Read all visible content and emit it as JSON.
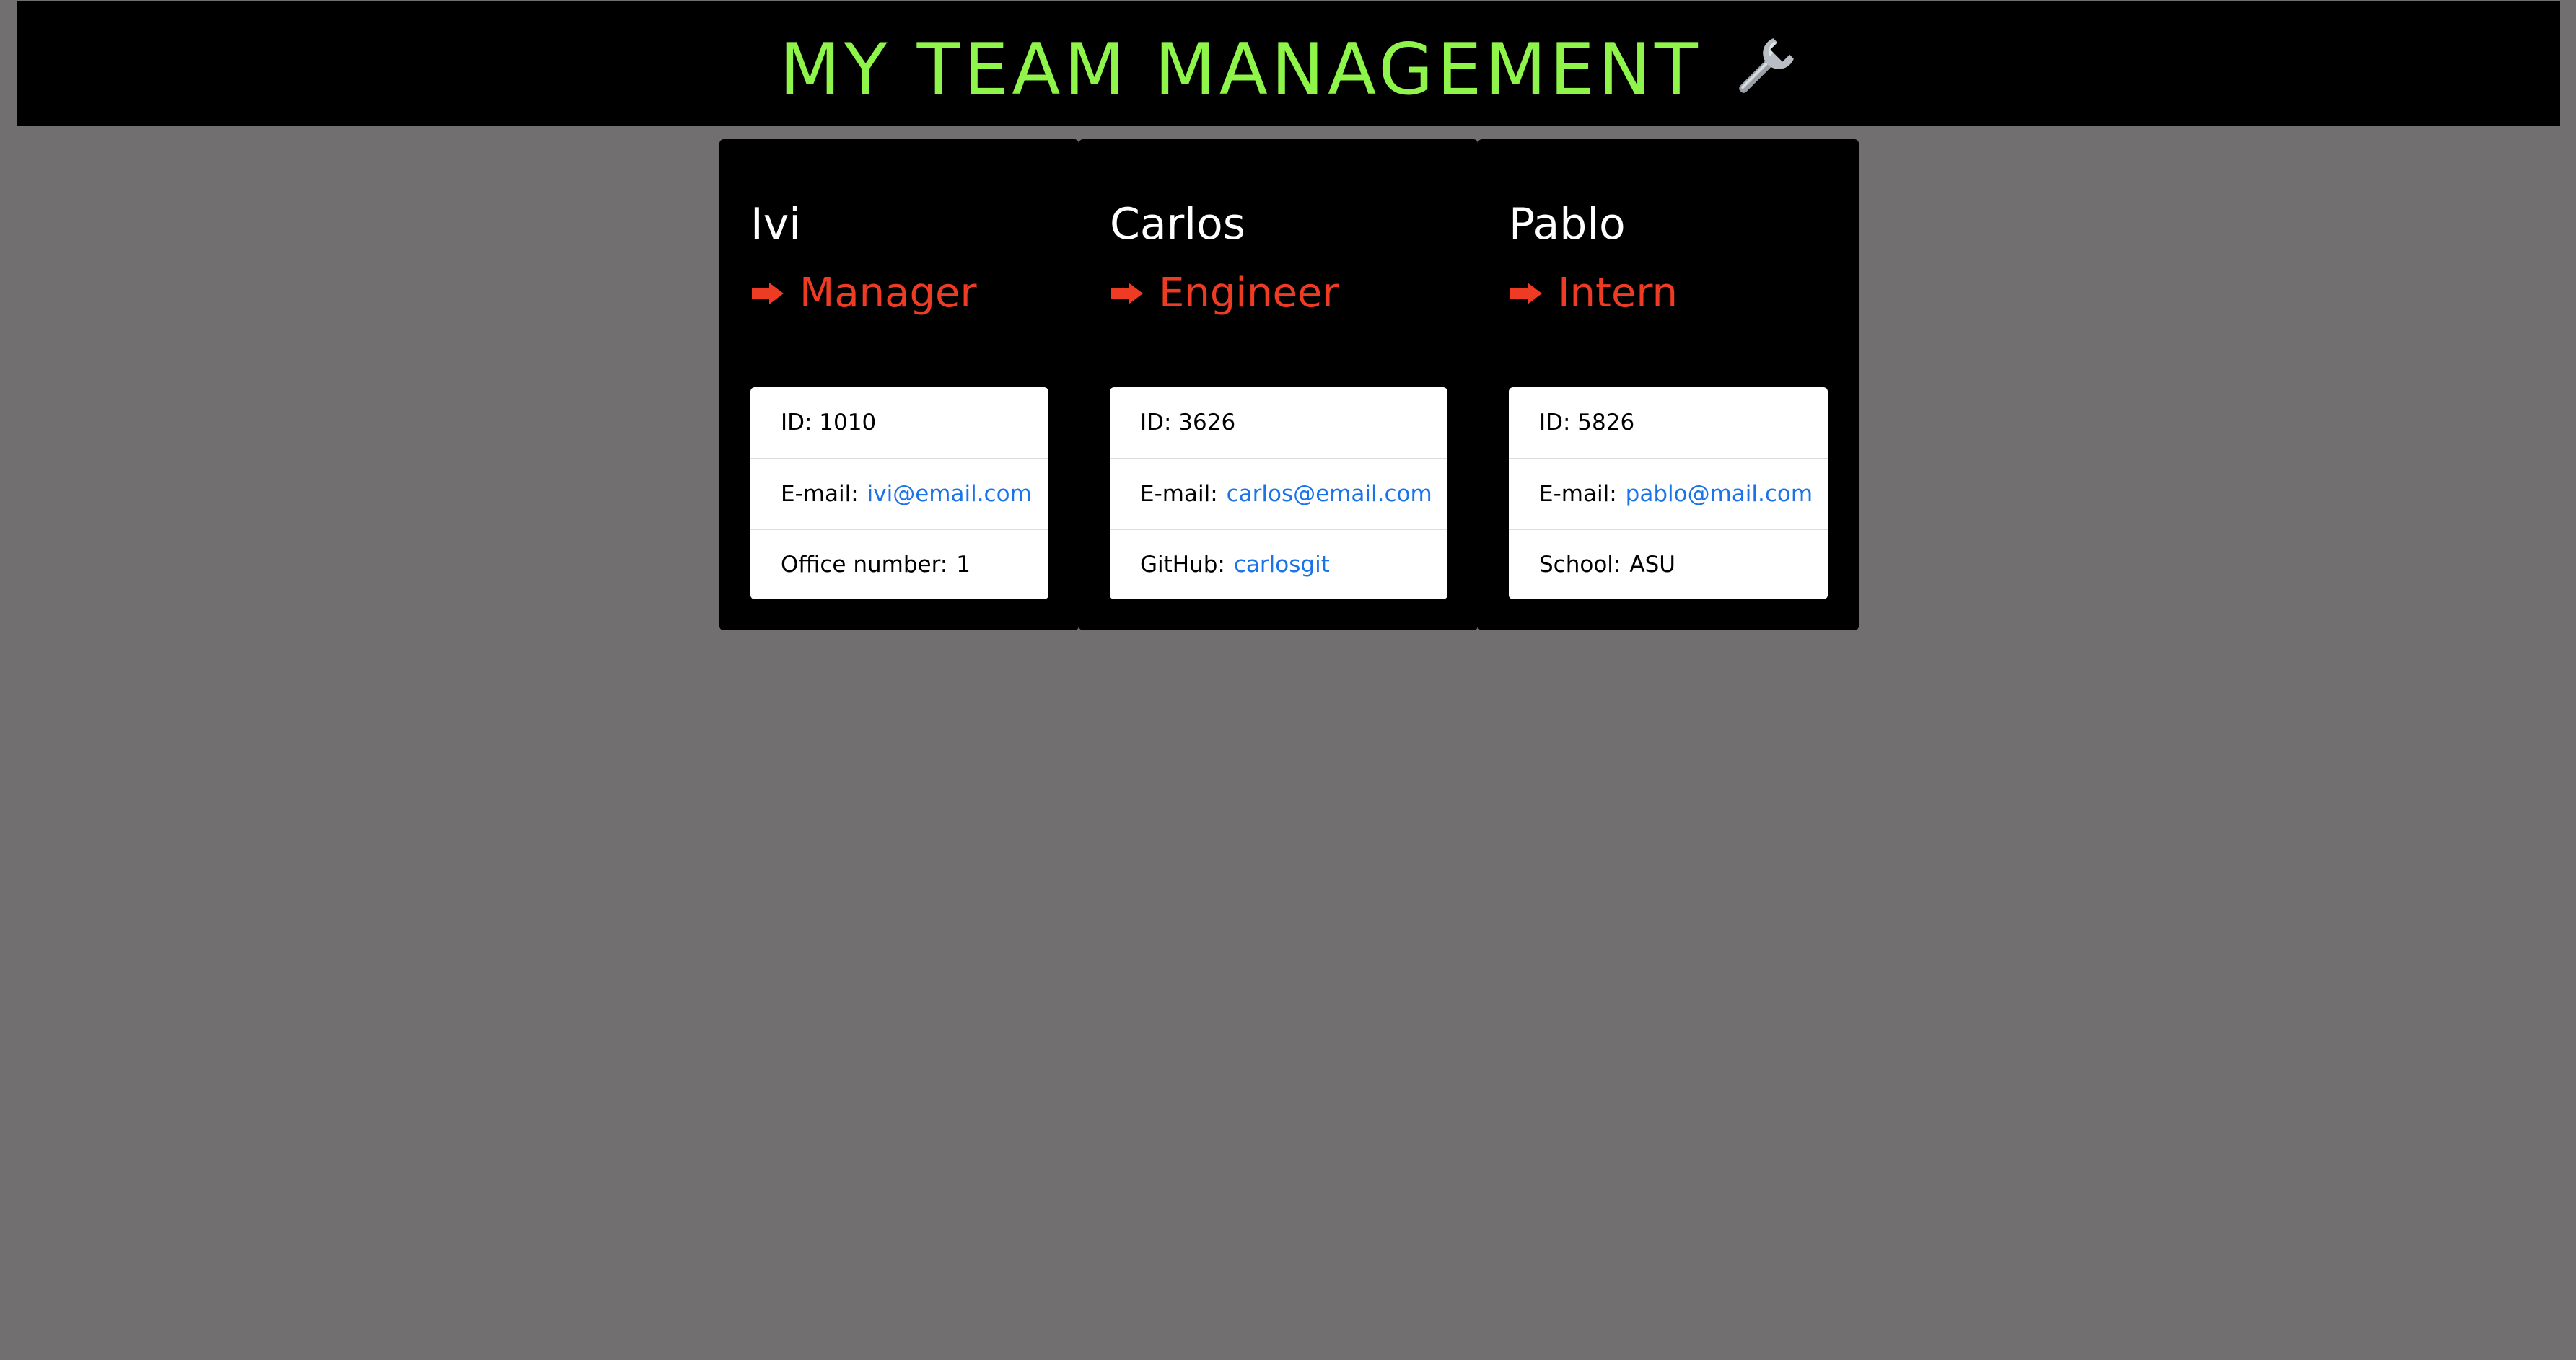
{
  "header": {
    "title": "MY TEAM MANAGEMENT",
    "icon": "wrench-icon"
  },
  "colors": {
    "background": "#716f70",
    "header_bg": "#000000",
    "title": "#8ff54a",
    "role": "#ee3b24",
    "link": "#1a73e8"
  },
  "team": [
    {
      "name": "Ivi",
      "role": "Manager",
      "id": "ID: 1010",
      "email_label": "E-mail:",
      "email": "ivi@email.com",
      "extra_label": "Office number:",
      "extra_value": "1"
    },
    {
      "name": "Carlos",
      "role": "Engineer",
      "id": "ID: 3626",
      "email_label": "E-mail:",
      "email": "carlos@email.com",
      "extra_label": "GitHub:",
      "extra_value": "carlosgit"
    },
    {
      "name": "Pablo",
      "role": "Intern",
      "id": "ID: 5826",
      "email_label": "E-mail:",
      "email": "pablo@mail.com",
      "extra_label": "School:",
      "extra_value": "ASU"
    }
  ]
}
